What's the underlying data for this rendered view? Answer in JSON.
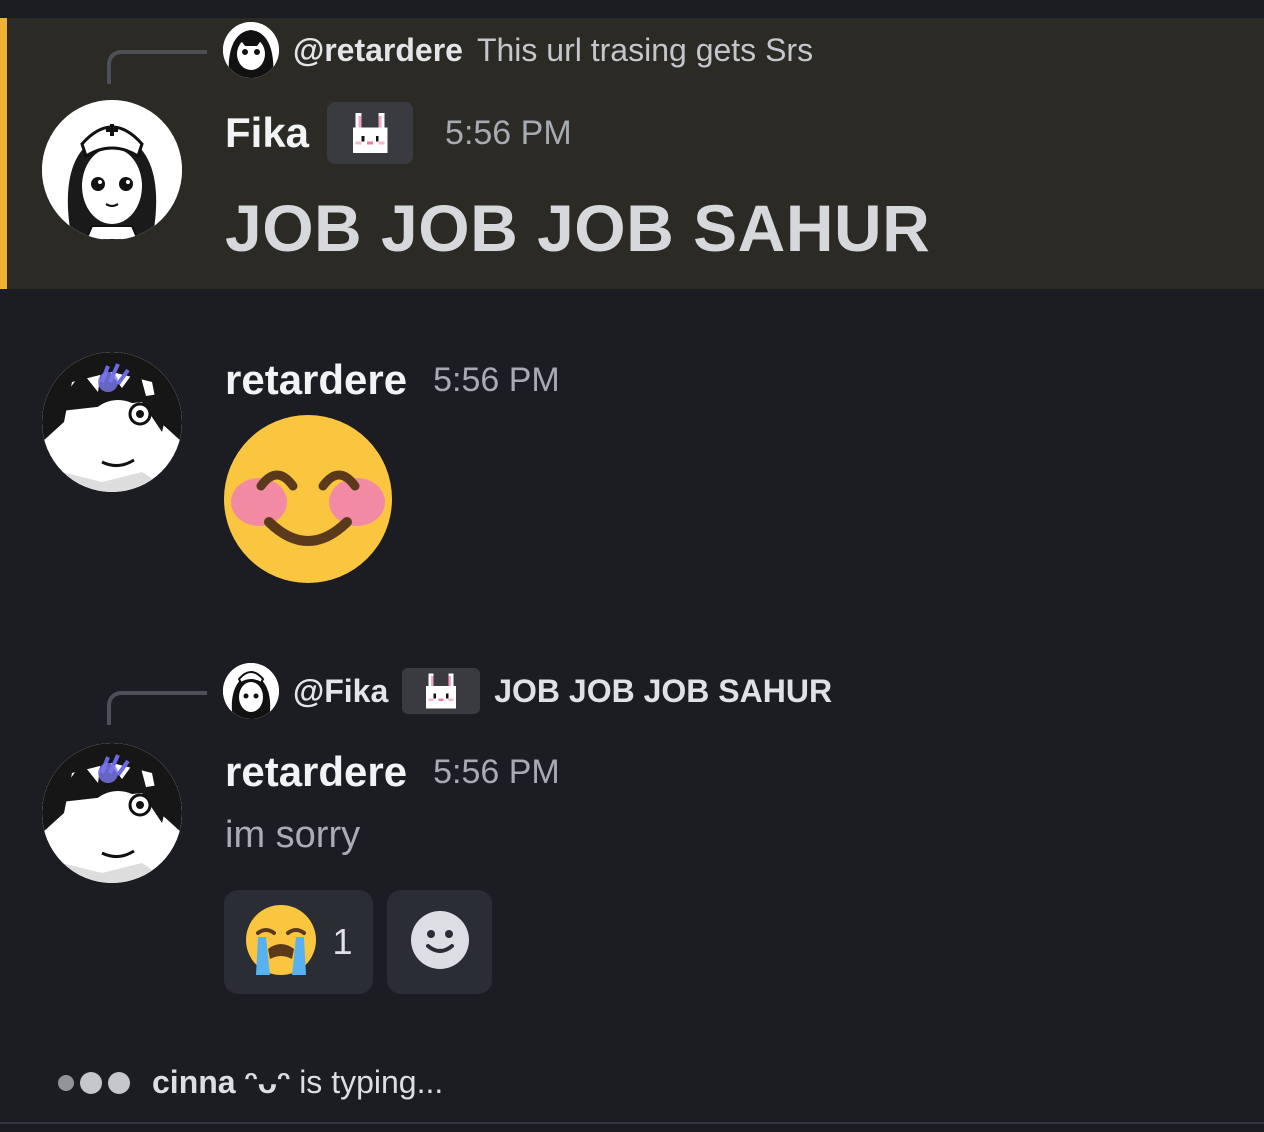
{
  "messages": [
    {
      "reply": {
        "name": "@retardere",
        "text": "This url trasing gets Srs"
      },
      "author": "Fika",
      "badge_icon": "bunny-pixel-icon",
      "time": "5:56 PM",
      "content": "JOB JOB JOB SAHUR",
      "highlighted": true,
      "accent_color": "#f0b232"
    },
    {
      "author": "retardere",
      "time": "5:56 PM",
      "content_emoji": "smiling-face-with-smiling-eyes-emoji"
    },
    {
      "reply": {
        "name": "@Fika",
        "badge_icon": "bunny-pixel-icon",
        "text": "JOB JOB JOB SAHUR"
      },
      "author": "retardere",
      "time": "5:56 PM",
      "content": "im sorry",
      "reactions": [
        {
          "emoji": "loudly-crying-face-emoji",
          "count": "1"
        },
        {
          "emoji": "add-reaction-icon"
        }
      ]
    }
  ],
  "typing": {
    "user": "cinna ᵔᴗᵔ",
    "suffix": " is typing..."
  }
}
